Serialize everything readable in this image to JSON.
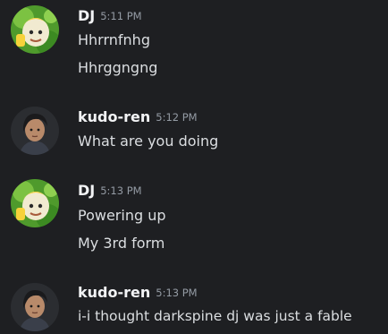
{
  "theme": {
    "background": "#1e1f22",
    "username_color": "#f2f3f5",
    "timestamp_color": "#949ba4",
    "text_color": "#dbdee1"
  },
  "messages": [
    {
      "author": "DJ",
      "avatar": "dj-avatar-icon",
      "timestamp": "5:11 PM",
      "lines": [
        "Hhrrnfnhg",
        "Hhrggngng"
      ]
    },
    {
      "author": "kudo-ren",
      "avatar": "kudo-ren-avatar-icon",
      "timestamp": "5:12 PM",
      "lines": [
        "What are you doing"
      ]
    },
    {
      "author": "DJ",
      "avatar": "dj-avatar-icon",
      "timestamp": "5:13 PM",
      "lines": [
        "Powering up",
        "My 3rd form"
      ]
    },
    {
      "author": "kudo-ren",
      "avatar": "kudo-ren-avatar-icon",
      "timestamp": "5:13 PM",
      "lines": [
        "i-i thought darkspine dj was just a fable"
      ]
    }
  ]
}
